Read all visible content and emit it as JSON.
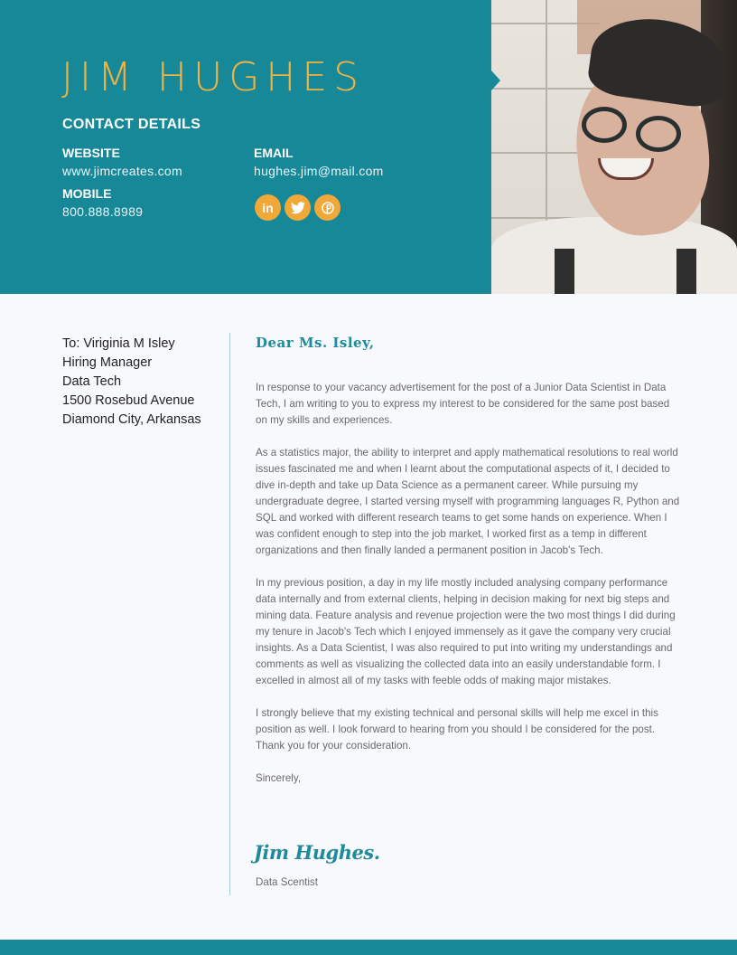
{
  "header": {
    "name": "JIM HUGHES",
    "contact_title": "CONTACT DETAILS",
    "website_label": "WEBSITE",
    "website_value": "www.jimcreates.com",
    "email_label": "EMAIL",
    "email_value": "hughes.jim@mail.com",
    "mobile_label": "MOBILE",
    "mobile_value": "800.888.8989",
    "socials": [
      {
        "icon": "linkedin-icon",
        "glyph": "in"
      },
      {
        "icon": "twitter-icon",
        "glyph": "🐦"
      },
      {
        "icon": "pinterest-icon",
        "glyph": "P"
      }
    ]
  },
  "colors": {
    "brand": "#168898",
    "accent": "#f0b342",
    "social": "#f0a838"
  },
  "recipient": {
    "lines": [
      "To: Viriginia M Isley",
      "Hiring Manager",
      "Data Tech",
      "1500 Rosebud Avenue",
      "Diamond City, Arkansas"
    ]
  },
  "letter": {
    "greeting": "Dear Ms. Isley,",
    "paragraphs": [
      "In response to your vacancy advertisement for the post of a Junior Data Scientist in Data Tech, I am writing to you to express my interest to be considered for the same post based on my skills and experiences.",
      "As a statistics major, the ability to interpret and apply mathematical resolutions to real world issues fascinated me and when I learnt about the computational aspects of it, I decided to dive in-depth and take up Data Science as a permanent career. While pursuing my undergraduate degree, I started versing myself with programming languages R, Python and SQL and worked with different research teams to get some hands on experience. When I was confident enough to step into the job market, I worked first as a temp in different organizations and then finally landed a permanent position in Jacob's Tech.",
      "In my previous position, a day in my life mostly included analysing company performance data internally and from external clients, helping in decision making for next big steps and mining data. Feature analysis and revenue projection were the two most things I did during my tenure in Jacob's Tech which I enjoyed immensely as it gave the company very crucial insights. As a Data Scientist, I was also required to put into writing my understandings and comments as well as visualizing the collected data into an easily understandable form. I excelled in almost all of my tasks with feeble odds of making major mistakes.",
      "I strongly believe that my existing technical and personal skills will help me excel in this position as well. I look forward to hearing from you should I be considered for the post. Thank you for your consideration.",
      "Sincerely,"
    ],
    "signature": "Jim Hughes.",
    "signature_title": "Data Scentist"
  }
}
